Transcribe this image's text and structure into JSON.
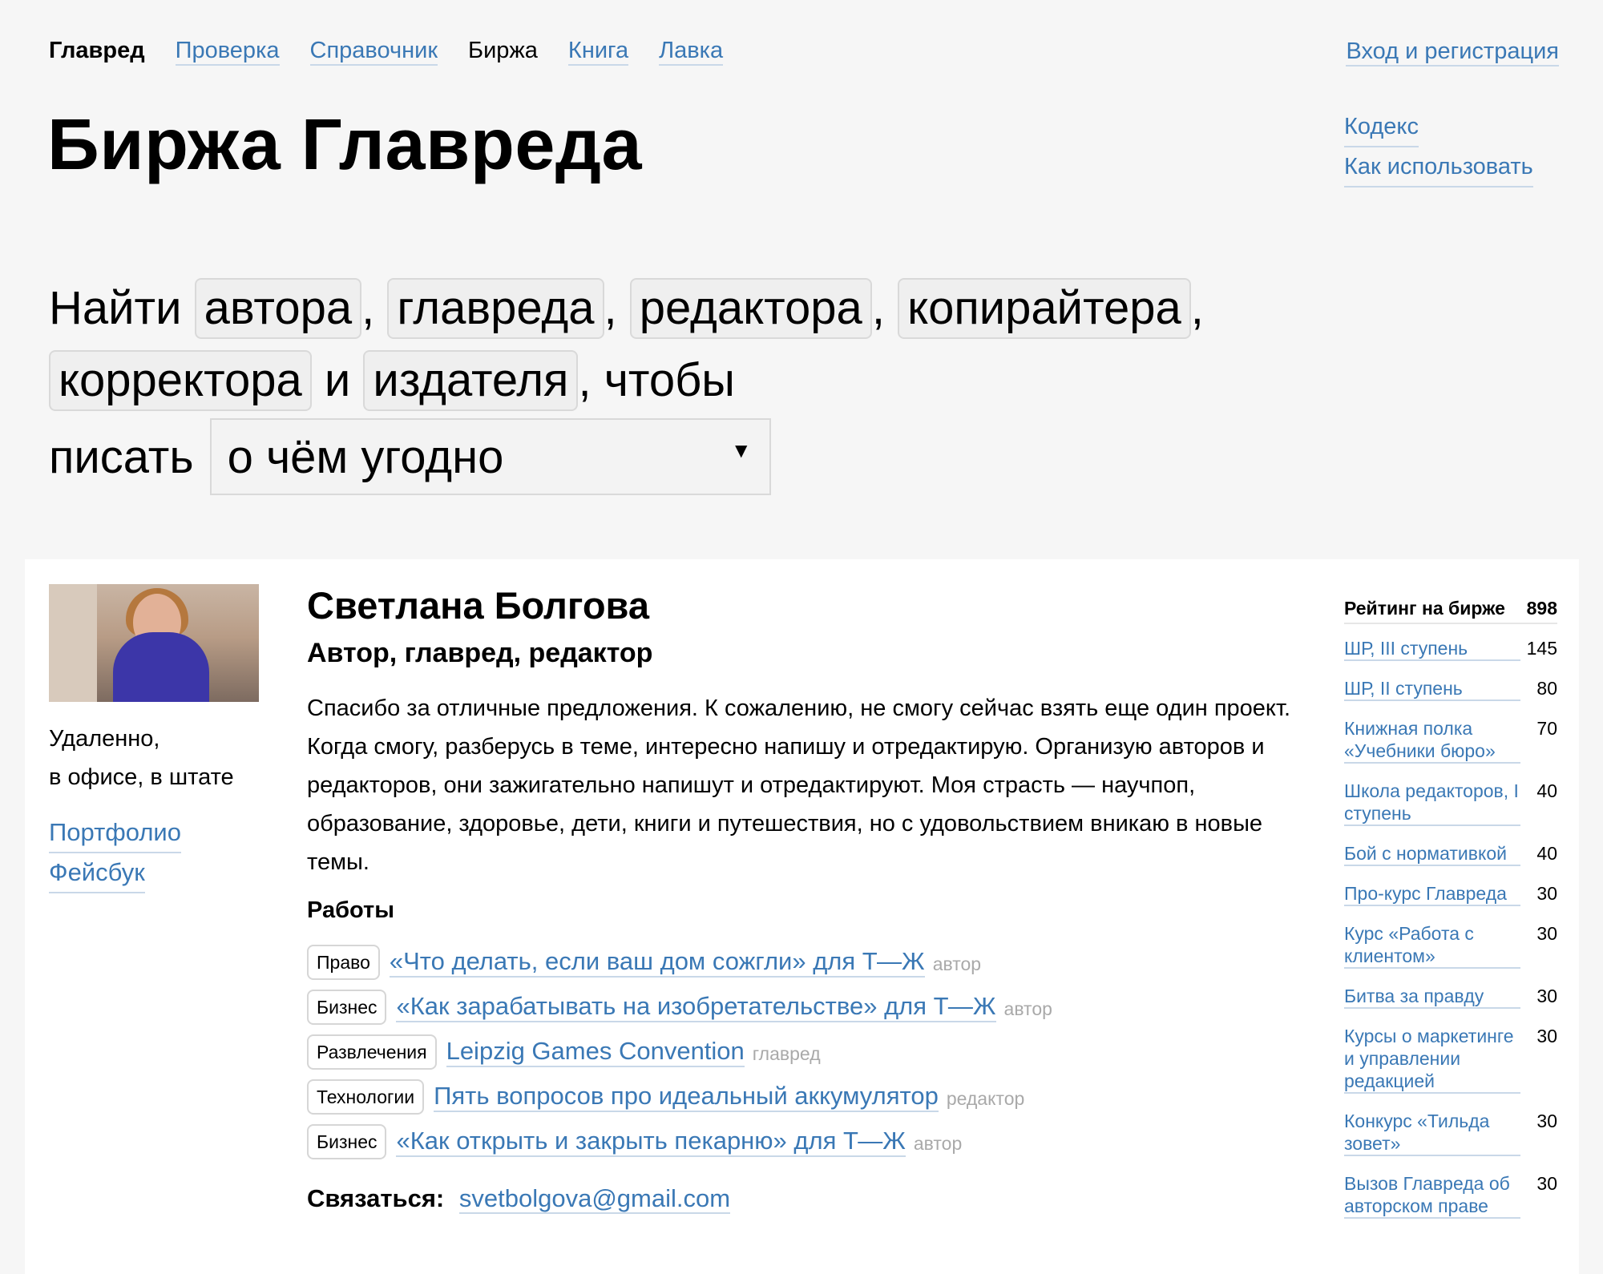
{
  "nav": {
    "items": [
      {
        "label": "Главред",
        "style": "bold"
      },
      {
        "label": "Проверка",
        "style": "link"
      },
      {
        "label": "Справочник",
        "style": "link"
      },
      {
        "label": "Биржа",
        "style": "plain"
      },
      {
        "label": "Книга",
        "style": "link"
      },
      {
        "label": "Лавка",
        "style": "link"
      }
    ],
    "login": "Вход и регистрация",
    "side_links": [
      "Кодекс",
      "Как использовать"
    ]
  },
  "page_title": "Биржа Главреда",
  "search": {
    "find_word": "Найти",
    "chips": [
      "автора",
      "главреда",
      "редактора",
      "копирайтера",
      "корректора",
      "издателя"
    ],
    "comma": ",",
    "and_word": "и",
    "suffix": ", чтобы",
    "write_word": "писать",
    "topic_selected": "о чём угодно",
    "arrow": "▼"
  },
  "profile": {
    "name": "Светлана Болгова",
    "roles": "Автор, главред, редактор",
    "location_line1": "Удаленно,",
    "location_line2": "в офисе, в штате",
    "portfolio": "Портфолио",
    "facebook": "Фейсбук",
    "about": "Спасибо за отличные предложения. К сожалению, не смогу сейчас взять еще один проект. Когда смогу, разберусь в теме, интересно напишу и отредактирую. Организую авторов и редакторов, они зажигательно напишут и отредактируют. Моя страсть — научпоп, образование, здоровье, дети, книги и путешествия, но с удовольствием вникаю в новые темы.",
    "works_heading": "Работы",
    "works": [
      {
        "tag": "Право",
        "title": "«Что делать, если ваш дом сожгли» для Т—Ж",
        "role": "автор"
      },
      {
        "tag": "Бизнес",
        "title": "«Как зарабатывать на изобретательстве» для Т—Ж",
        "role": "автор"
      },
      {
        "tag": "Развлечения",
        "title": "Leipzig Games Convention",
        "role": "главред"
      },
      {
        "tag": "Технологии",
        "title": "Пять вопросов про идеальный аккумулятор",
        "role": "редактор"
      },
      {
        "tag": "Бизнес",
        "title": "«Как открыть и закрыть пекарню» для Т—Ж",
        "role": "автор"
      }
    ],
    "contact_label": "Связаться:",
    "contact_email": "svetbolgova@gmail.com"
  },
  "rating": {
    "label": "Рейтинг на бирже",
    "total": "898",
    "items": [
      {
        "label": "ШР, III ступень",
        "points": "145"
      },
      {
        "label": "ШР, II ступень",
        "points": "80"
      },
      {
        "label": "Книжная полка «Учебники бюро»",
        "points": "70"
      },
      {
        "label": "Школа редакторов, I ступень",
        "points": "40"
      },
      {
        "label": "Бой с нормативкой",
        "points": "40"
      },
      {
        "label": "Про-курс Главреда",
        "points": "30"
      },
      {
        "label": "Курс «Работа с клиентом»",
        "points": "30"
      },
      {
        "label": "Битва за правду",
        "points": "30"
      },
      {
        "label": "Курсы о маркетинге и управлении редакцией",
        "points": "30"
      },
      {
        "label": "Конкурс «Тильда зовет»",
        "points": "30"
      },
      {
        "label": "Вызов Главреда об авторском праве",
        "points": "30"
      }
    ]
  },
  "colors": {
    "link": "#3a78b5",
    "background": "#f6f6f6",
    "card": "#ffffff",
    "muted": "#a9a9a9"
  }
}
